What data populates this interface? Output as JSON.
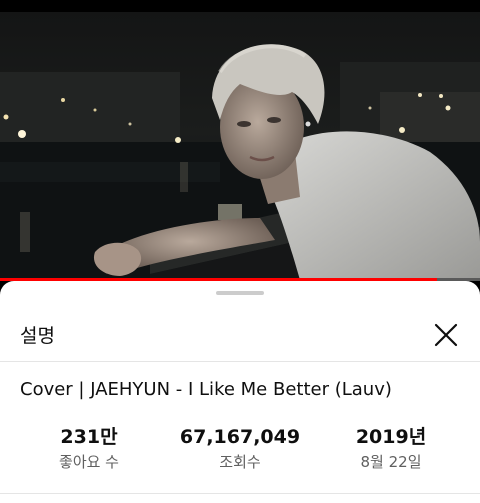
{
  "player": {
    "progress": 0.91,
    "progress_color": "#ff0000",
    "thumbnail_description": "man in white t-shirt leaning on a railing at night with city lights"
  },
  "sheet": {
    "title": "설명",
    "close_icon": "close-icon",
    "video_title": "Cover | JAEHYUN - I Like Me Better (Lauv)",
    "stats": {
      "likes": {
        "value": "231만",
        "label": "좋아요 수"
      },
      "views": {
        "value": "67,167,049",
        "label": "조회수"
      },
      "date": {
        "value": "2019년",
        "label": "8월 22일"
      }
    }
  }
}
